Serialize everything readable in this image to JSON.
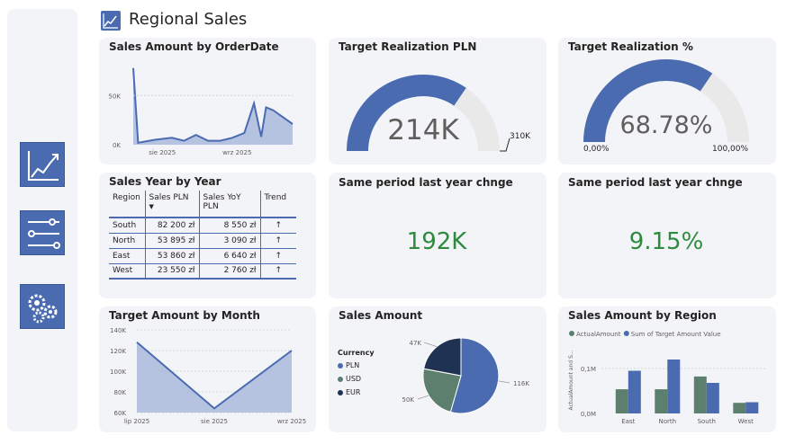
{
  "page": {
    "title": "Regional Sales"
  },
  "nav": [
    {
      "name": "analytics-icon"
    },
    {
      "name": "filters-icon"
    },
    {
      "name": "settings-icon"
    }
  ],
  "colors": {
    "primary": "#4a6bb0",
    "area": "#a9b8dc",
    "green": "#2e8b3e",
    "gauge_bg": "#e9e9e9",
    "teal": "#5c7f6e",
    "navy": "#1f3252"
  },
  "sales_by_orderdate": {
    "title": "Sales Amount by OrderDate",
    "y_ticks": [
      "50K",
      "0K"
    ],
    "x_ticks": [
      "sie 2025",
      "wrz 2025"
    ]
  },
  "target_realization_pln": {
    "title": "Target Realization PLN",
    "value": "214K",
    "target": "310K"
  },
  "target_realization_pct": {
    "title": "Target Realization %",
    "value": "68.78%",
    "min": "0,00%",
    "max": "100,00%"
  },
  "same_period_pln": {
    "title": "Same period last year chnge",
    "value": "192K"
  },
  "same_period_pct": {
    "title": "Same period last year chnge",
    "value": "9.15%"
  },
  "sales_year_by_year": {
    "title": "Sales Year by Year",
    "headers": [
      "Region",
      "Sales PLN",
      "Sales YoY PLN",
      "Trend"
    ],
    "rows": [
      {
        "region": "South",
        "sales": "82 200 zł",
        "yoy": "8 550 zł",
        "trend": "↑"
      },
      {
        "region": "North",
        "sales": "53 895 zł",
        "yoy": "3 090 zł",
        "trend": "↑"
      },
      {
        "region": "East",
        "sales": "53 860 zł",
        "yoy": "6 640 zł",
        "trend": "↑"
      },
      {
        "region": "West",
        "sales": "23 550 zł",
        "yoy": "2 760 zł",
        "trend": "↑"
      }
    ]
  },
  "chart_data": [
    {
      "type": "area",
      "title": "Sales Amount by OrderDate",
      "x": [
        "2025-07-20",
        "2025-07-22",
        "2025-07-29",
        "2025-08-05",
        "2025-08-10",
        "2025-08-15",
        "2025-08-20",
        "2025-08-25",
        "2025-08-30",
        "2025-09-04",
        "2025-09-08",
        "2025-09-11",
        "2025-09-13",
        "2025-09-16",
        "2025-09-24"
      ],
      "values": [
        78000,
        2000,
        5000,
        7000,
        4000,
        10000,
        4000,
        4000,
        7000,
        12000,
        42000,
        8000,
        38000,
        35000,
        21000
      ],
      "y_ticks": [
        "50K",
        "0K"
      ],
      "x_ticks": [
        "sie 2025",
        "wrz 2025"
      ],
      "ylim": [
        0,
        85000
      ]
    },
    {
      "type": "area",
      "title": "Target Amount by Month",
      "categories": [
        "lip 2025",
        "sie 2025",
        "wrz 2025"
      ],
      "values": [
        128000,
        64000,
        120000
      ],
      "y_ticks": [
        "140K",
        "120K",
        "100K",
        "80K",
        "60K"
      ],
      "ylim": [
        60000,
        140000
      ]
    },
    {
      "type": "pie",
      "title": "Sales Amount",
      "legend_title": "Currency",
      "slices": [
        {
          "name": "PLN",
          "value": 116000,
          "label": "116K",
          "color": "#4a6bb0"
        },
        {
          "name": "USD",
          "value": 50000,
          "label": "50K",
          "color": "#5c7f6e"
        },
        {
          "name": "EUR",
          "value": 47000,
          "label": "47K",
          "color": "#1f3252"
        }
      ]
    },
    {
      "type": "bar",
      "title": "Sales Amount by Region",
      "categories": [
        "East",
        "North",
        "South",
        "West"
      ],
      "series": [
        {
          "name": "ActualAmount",
          "values": [
            53860,
            53895,
            82200,
            23550
          ],
          "color": "#5c7f6e"
        },
        {
          "name": "Sum of Target Amount Value",
          "values": [
            95000,
            120000,
            68000,
            25000
          ],
          "color": "#4a6bb0"
        }
      ],
      "ylabel": "ActualAmount and S...",
      "y_ticks": [
        "0,1M",
        "0,0M"
      ],
      "ylim": [
        0,
        150000
      ]
    }
  ]
}
